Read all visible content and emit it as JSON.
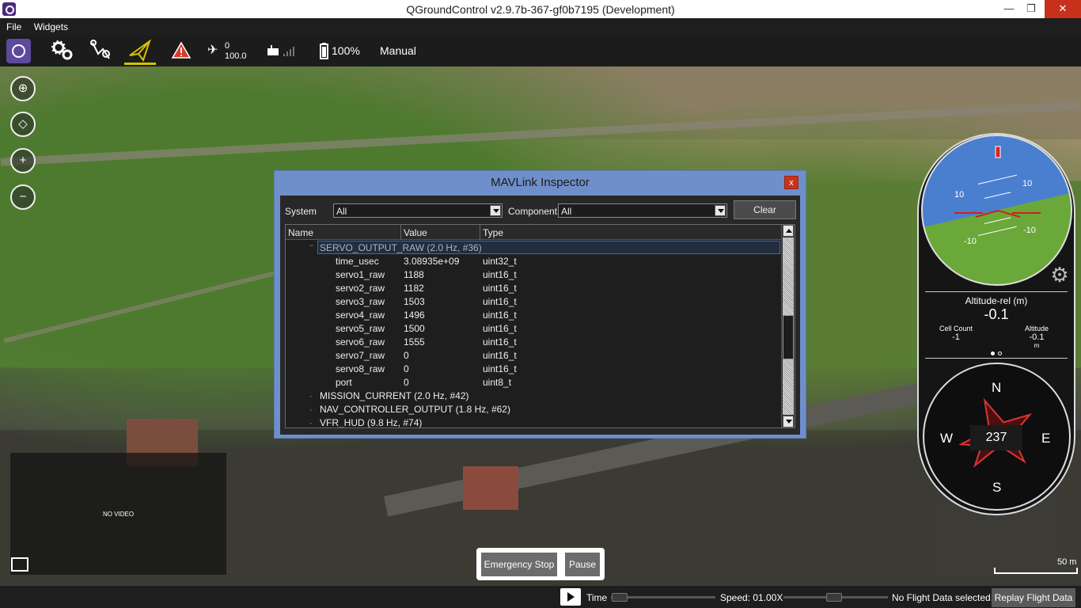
{
  "window": {
    "title": "QGroundControl v2.9.7b-367-gf0b7195 (Development)",
    "minimize": "—",
    "maximize": "❐",
    "close": "✕"
  },
  "menu": {
    "file": "File",
    "widgets": "Widgets"
  },
  "toolbar": {
    "gps_count": "0",
    "gps_hdop": "100.0",
    "battery": "100%",
    "flight_mode": "Manual"
  },
  "map": {
    "no_video": "NO VIDEO",
    "scale": "50 m"
  },
  "emergency": {
    "stop": "Emergency Stop",
    "pause": "Pause"
  },
  "inspector": {
    "title": "MAVLink Inspector",
    "close": "x",
    "system_label": "System",
    "system_value": "All",
    "component_label": "Component",
    "component_value": "All",
    "clear": "Clear",
    "columns": [
      "Name",
      "Value",
      "Type"
    ],
    "selected_message": "SERVO_OUTPUT_RAW (2.0 Hz, #36)",
    "fields": [
      {
        "name": "time_usec",
        "value": "3.08935e+09",
        "type": "uint32_t"
      },
      {
        "name": "servo1_raw",
        "value": "1188",
        "type": "uint16_t"
      },
      {
        "name": "servo2_raw",
        "value": "1182",
        "type": "uint16_t"
      },
      {
        "name": "servo3_raw",
        "value": "1503",
        "type": "uint16_t"
      },
      {
        "name": "servo4_raw",
        "value": "1496",
        "type": "uint16_t"
      },
      {
        "name": "servo5_raw",
        "value": "1500",
        "type": "uint16_t"
      },
      {
        "name": "servo6_raw",
        "value": "1555",
        "type": "uint16_t"
      },
      {
        "name": "servo7_raw",
        "value": "0",
        "type": "uint16_t"
      },
      {
        "name": "servo8_raw",
        "value": "0",
        "type": "uint16_t"
      },
      {
        "name": "port",
        "value": "0",
        "type": "uint8_t"
      }
    ],
    "messages": [
      "MISSION_CURRENT (2.0 Hz, #42)",
      "NAV_CONTROLLER_OUTPUT (1.8 Hz, #62)",
      "VFR_HUD (9.8 Hz, #74)"
    ]
  },
  "instruments": {
    "pitch_labels": [
      "10",
      "10",
      "-10",
      "-10"
    ],
    "altitude_title": "Altitude-rel (m)",
    "altitude_value": "-0.1",
    "cell_count_label": "Cell Count",
    "cell_count_value": "-1",
    "altitude_label": "Altitude",
    "altitude_small": "-0.1",
    "altitude_unit": "m",
    "heading": "237",
    "cardinal": {
      "n": "N",
      "e": "E",
      "s": "S",
      "w": "W"
    }
  },
  "replay": {
    "time_label": "Time",
    "speed": "Speed: 01.00X",
    "status": "No Flight Data selected..",
    "button": "Replay Flight Data"
  },
  "colors": {
    "accent": "#d6c300",
    "inspector_frame": "#6f8fcb",
    "close_red": "#c7311b",
    "logo": "#5d4a9e"
  }
}
